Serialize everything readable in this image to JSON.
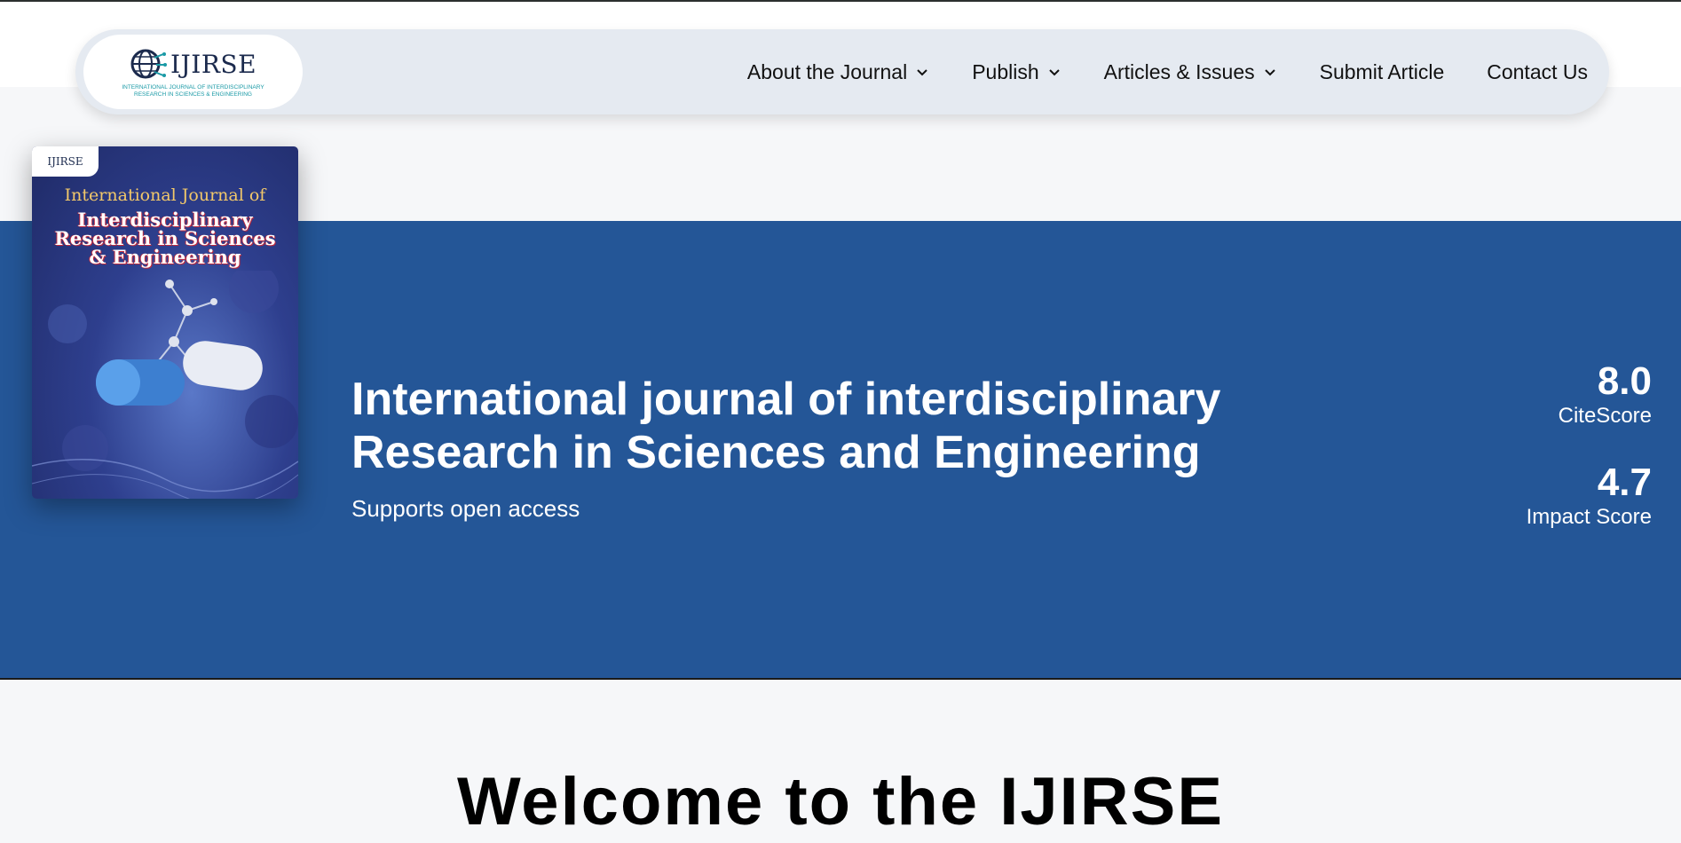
{
  "header": {
    "logo": {
      "title": "IJIRSE",
      "subtitle": "INTERNATIONAL JOURNAL OF INTERDISCIPLINARY RESEARCH IN SCIENCES & ENGINEERING",
      "icon": "globe-circuit-icon"
    },
    "nav": [
      {
        "label": "About the Journal",
        "dropdown": true
      },
      {
        "label": "Publish",
        "dropdown": true
      },
      {
        "label": "Articles & Issues",
        "dropdown": true
      },
      {
        "label": "Submit Article",
        "dropdown": false
      },
      {
        "label": "Contact Us",
        "dropdown": false
      }
    ]
  },
  "hero": {
    "cover": {
      "logo_title": "IJIRSE",
      "line1": "International Journal of",
      "line2a": "Interdisciplinary",
      "line2b": "Research in Sciences",
      "line2c": "& Engineering"
    },
    "title_line1": "International journal of interdisciplinary",
    "title_line2": "Research in Sciences and Engineering",
    "subtitle": "Supports open access",
    "metrics": [
      {
        "value": "8.0",
        "label": "CiteScore"
      },
      {
        "value": "4.7",
        "label": "Impact Score"
      }
    ]
  },
  "welcome": {
    "heading": "Welcome to the IJIRSE"
  },
  "colors": {
    "hero_bg": "#245697",
    "header_bg": "#e5eaf1",
    "logo_accent": "#1a9aa6",
    "logo_dark": "#1b2a4d"
  }
}
